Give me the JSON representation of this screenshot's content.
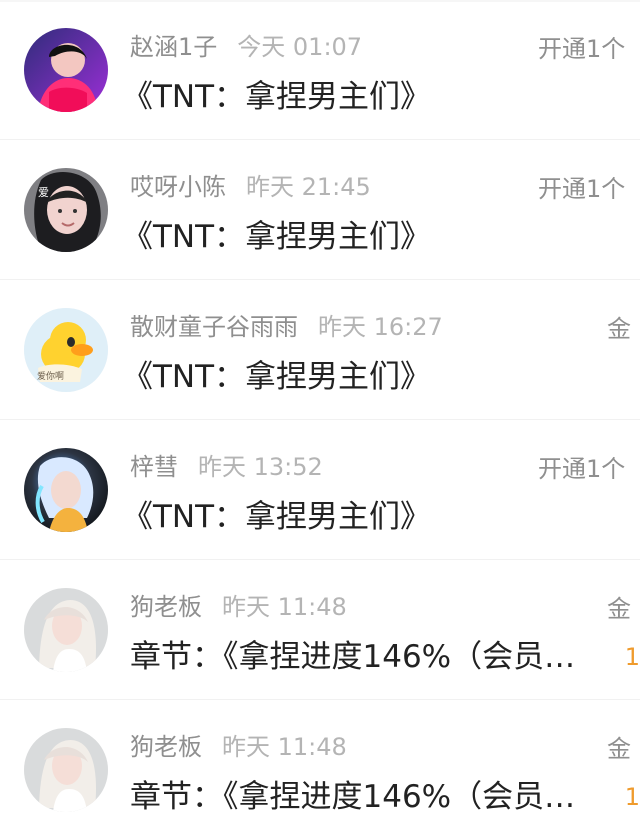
{
  "items": [
    {
      "name": "赵涵1子",
      "time": "今天 01:07",
      "right_label": "开通1个",
      "title": "《TNT：拿捏男主们》",
      "avatar": "girl-pink-hoodie-avatar"
    },
    {
      "name": "哎呀小陈",
      "time": "昨天 21:45",
      "right_label": "开通1个",
      "title": "《TNT：拿捏男主们》",
      "avatar": "girl-selfie-avatar"
    },
    {
      "name": "散财童子谷雨雨",
      "time": "昨天 16:27",
      "right_label": "金",
      "title": "《TNT：拿捏男主们》",
      "avatar": "yellow-duck-avatar"
    },
    {
      "name": "梓彗",
      "time": "昨天 13:52",
      "right_label": "开通1个",
      "title": "《TNT：拿捏男主们》",
      "avatar": "glowing-girl-avatar"
    },
    {
      "name": "狗老板",
      "time": "昨天 11:48",
      "right_label": "金",
      "title": "章节：《拿捏进度146%（会员…",
      "avatar": "long-hair-girl-avatar"
    },
    {
      "name": "狗老板",
      "time": "昨天 11:48",
      "right_label": "金",
      "title": "章节：《拿捏进度146%（会员…",
      "avatar": "long-hair-girl-avatar"
    }
  ]
}
